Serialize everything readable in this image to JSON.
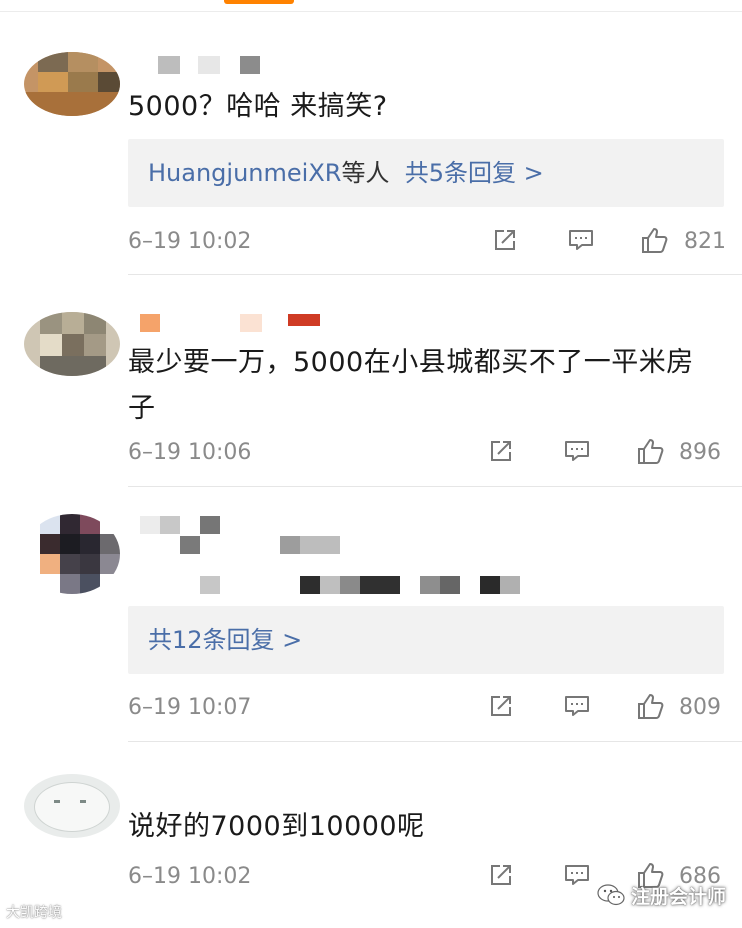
{
  "comments": [
    {
      "text": "5000？哈哈 来搞笑?",
      "reply_names": "HuangjunmeiXR",
      "reply_deng": "等人",
      "reply_count_text": "共5条回复 >",
      "time": "6–19 10:02",
      "likes": "821"
    },
    {
      "text": "最少要一万，5000在小县城都买不了一平米房子",
      "time": "6–19 10:06",
      "likes": "896"
    },
    {
      "reply_count_text": "共12条回复 >",
      "time": "6–19 10:07",
      "likes": "809"
    },
    {
      "text": "说好的7000到10000呢",
      "time": "6–19 10:02",
      "likes": "686"
    }
  ],
  "icons": {
    "share": "share-icon",
    "comment": "comment-icon",
    "like": "thumbs-up-icon"
  },
  "colors": {
    "accent": "#ff8200",
    "link": "#4a6ea8",
    "meta": "#8a8a8a",
    "reply_bg": "#f2f2f2"
  },
  "watermarks": {
    "left": "大凯跨境",
    "right": "注册会计师"
  }
}
